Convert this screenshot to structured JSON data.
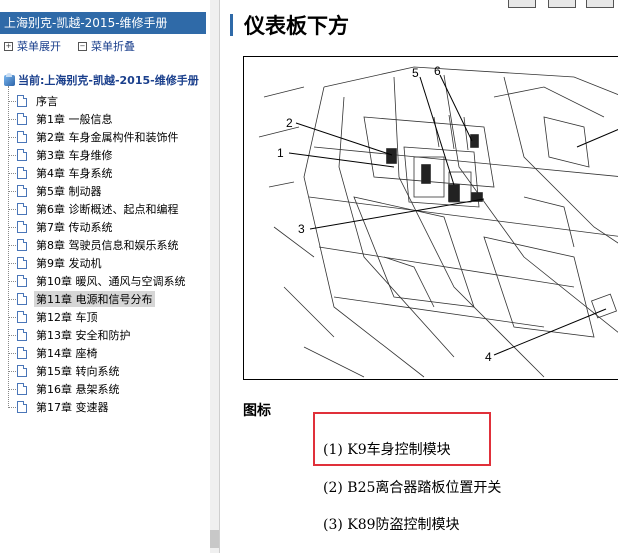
{
  "sidebar": {
    "title": "上海别克-凯越-2015-维修手册",
    "expand_label": "菜单展开",
    "collapse_label": "菜单折叠",
    "root_label": "当前:上海别克-凯越-2015-维修手册",
    "items": [
      {
        "label": "序言"
      },
      {
        "label": "第1章 一般信息"
      },
      {
        "label": "第2章 车身金属构件和装饰件"
      },
      {
        "label": "第3章 车身维修"
      },
      {
        "label": "第4章 车身系统"
      },
      {
        "label": "第5章 制动器"
      },
      {
        "label": "第6章 诊断概述、起点和编程"
      },
      {
        "label": "第7章 传动系统"
      },
      {
        "label": "第8章 驾驶员信息和娱乐系统"
      },
      {
        "label": "第9章 发动机"
      },
      {
        "label": "第10章 暖风、通风与空调系统"
      },
      {
        "label": "第11章 电源和信号分布",
        "selected": true
      },
      {
        "label": "第12章 车顶"
      },
      {
        "label": "第13章 安全和防护"
      },
      {
        "label": "第14章 座椅"
      },
      {
        "label": "第15章 转向系统"
      },
      {
        "label": "第16章 悬架系统"
      },
      {
        "label": "第17章 变速器"
      }
    ]
  },
  "main": {
    "page_title": "仪表板下方",
    "figure_callouts": [
      "1",
      "2",
      "3",
      "4",
      "5",
      "6"
    ],
    "legend_heading": "图标",
    "legend_items": [
      {
        "label": "(1) K9车身控制模块"
      },
      {
        "label": "(2) B25离合器踏板位置开关"
      },
      {
        "label": "(3) K89防盗控制模块"
      }
    ],
    "highlight_color": "#e0303a",
    "accent_color": "#2f6aa8"
  }
}
